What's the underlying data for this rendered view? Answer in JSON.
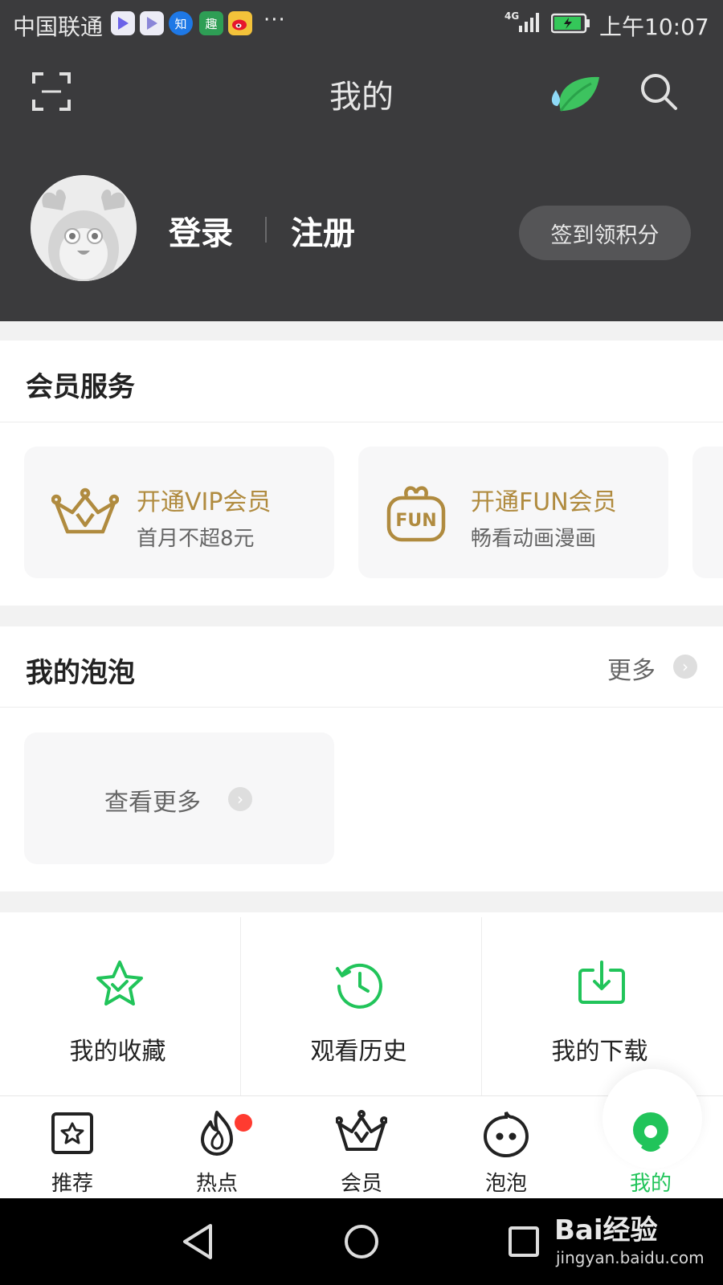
{
  "status_bar": {
    "carrier": "中国联通",
    "app_icons": [
      {
        "name": "video-app-icon",
        "label": "",
        "color": "#7a6ef0"
      },
      {
        "name": "video-app-icon-2",
        "label": "",
        "color": "#8a86d8"
      },
      {
        "name": "zhihu-icon",
        "label": "知",
        "color": "#1e78e6"
      },
      {
        "name": "qu-app-icon",
        "label": "趣",
        "color": "#2e9e55"
      },
      {
        "name": "weibo-icon",
        "label": "",
        "color": "#f0b030"
      }
    ],
    "more": "···",
    "network": "4G",
    "time": "上午10:07"
  },
  "header": {
    "title": "我的",
    "icons": [
      "scan-icon",
      "leaf-icon",
      "search-icon"
    ]
  },
  "profile": {
    "login": "登录",
    "register": "注册",
    "checkin_button": "签到领积分"
  },
  "membership": {
    "title": "会员服务",
    "cards": [
      {
        "title": "开通VIP会员",
        "subtitle": "首月不超8元",
        "icon": "vip-crown-icon"
      },
      {
        "title": "开通FUN会员",
        "subtitle": "畅看动画漫画",
        "icon": "fun-bag-icon"
      }
    ],
    "accent_color": "#b08b3f"
  },
  "bubbles": {
    "title": "我的泡泡",
    "more_label": "更多",
    "card_label": "查看更多"
  },
  "quick_actions": [
    {
      "label": "我的收藏",
      "icon": "star-icon"
    },
    {
      "label": "观看历史",
      "icon": "history-icon"
    },
    {
      "label": "我的下载",
      "icon": "download-icon"
    }
  ],
  "tabbar": {
    "active_color": "#21c45a",
    "tabs": [
      {
        "label": "推荐",
        "icon": "recommend-icon",
        "active": false
      },
      {
        "label": "热点",
        "icon": "hot-icon",
        "active": false,
        "badge": true
      },
      {
        "label": "会员",
        "icon": "member-crown-icon",
        "active": false
      },
      {
        "label": "泡泡",
        "icon": "bubble-face-icon",
        "active": false
      },
      {
        "label": "我的",
        "icon": "profile-icon",
        "active": true
      }
    ]
  },
  "nav_bar": {
    "buttons": [
      "back-icon",
      "home-icon",
      "recents-icon"
    ]
  },
  "watermark": {
    "brand": "Bai经验",
    "url": "jingyan.baidu.com"
  }
}
